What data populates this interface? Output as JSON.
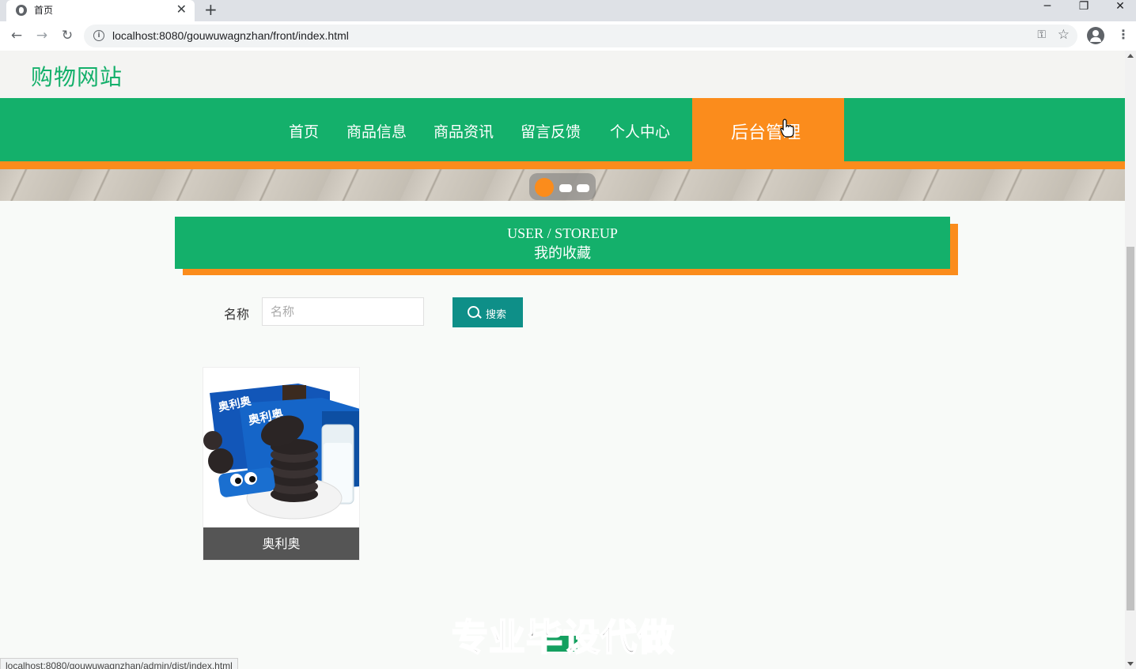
{
  "browser": {
    "tab_title": "首页",
    "tab_close": "✕",
    "new_tab": "+",
    "url": "localhost:8080/gouwuwagnzhan/front/index.html",
    "status_url": "localhost:8080/gouwuwagnzhan/admin/dist/index.html",
    "controls": {
      "minimize": "─",
      "restore": "❐",
      "close": "✕"
    }
  },
  "site": {
    "logo": "购物网站",
    "nav": [
      "首页",
      "商品信息",
      "商品资讯",
      "留言反馈",
      "个人中心"
    ],
    "nav_active": "后台管理"
  },
  "section": {
    "title_en": "USER / STOREUP",
    "title_zh": "我的收藏"
  },
  "search": {
    "label": "名称",
    "placeholder": "名称",
    "button": "搜索"
  },
  "products": [
    {
      "name": "奥利奥"
    }
  ],
  "watermark": "专业毕设代做",
  "colors": {
    "brand_green": "#14b06b",
    "accent_orange": "#fb8c1c",
    "button_teal": "#0e8f88"
  }
}
